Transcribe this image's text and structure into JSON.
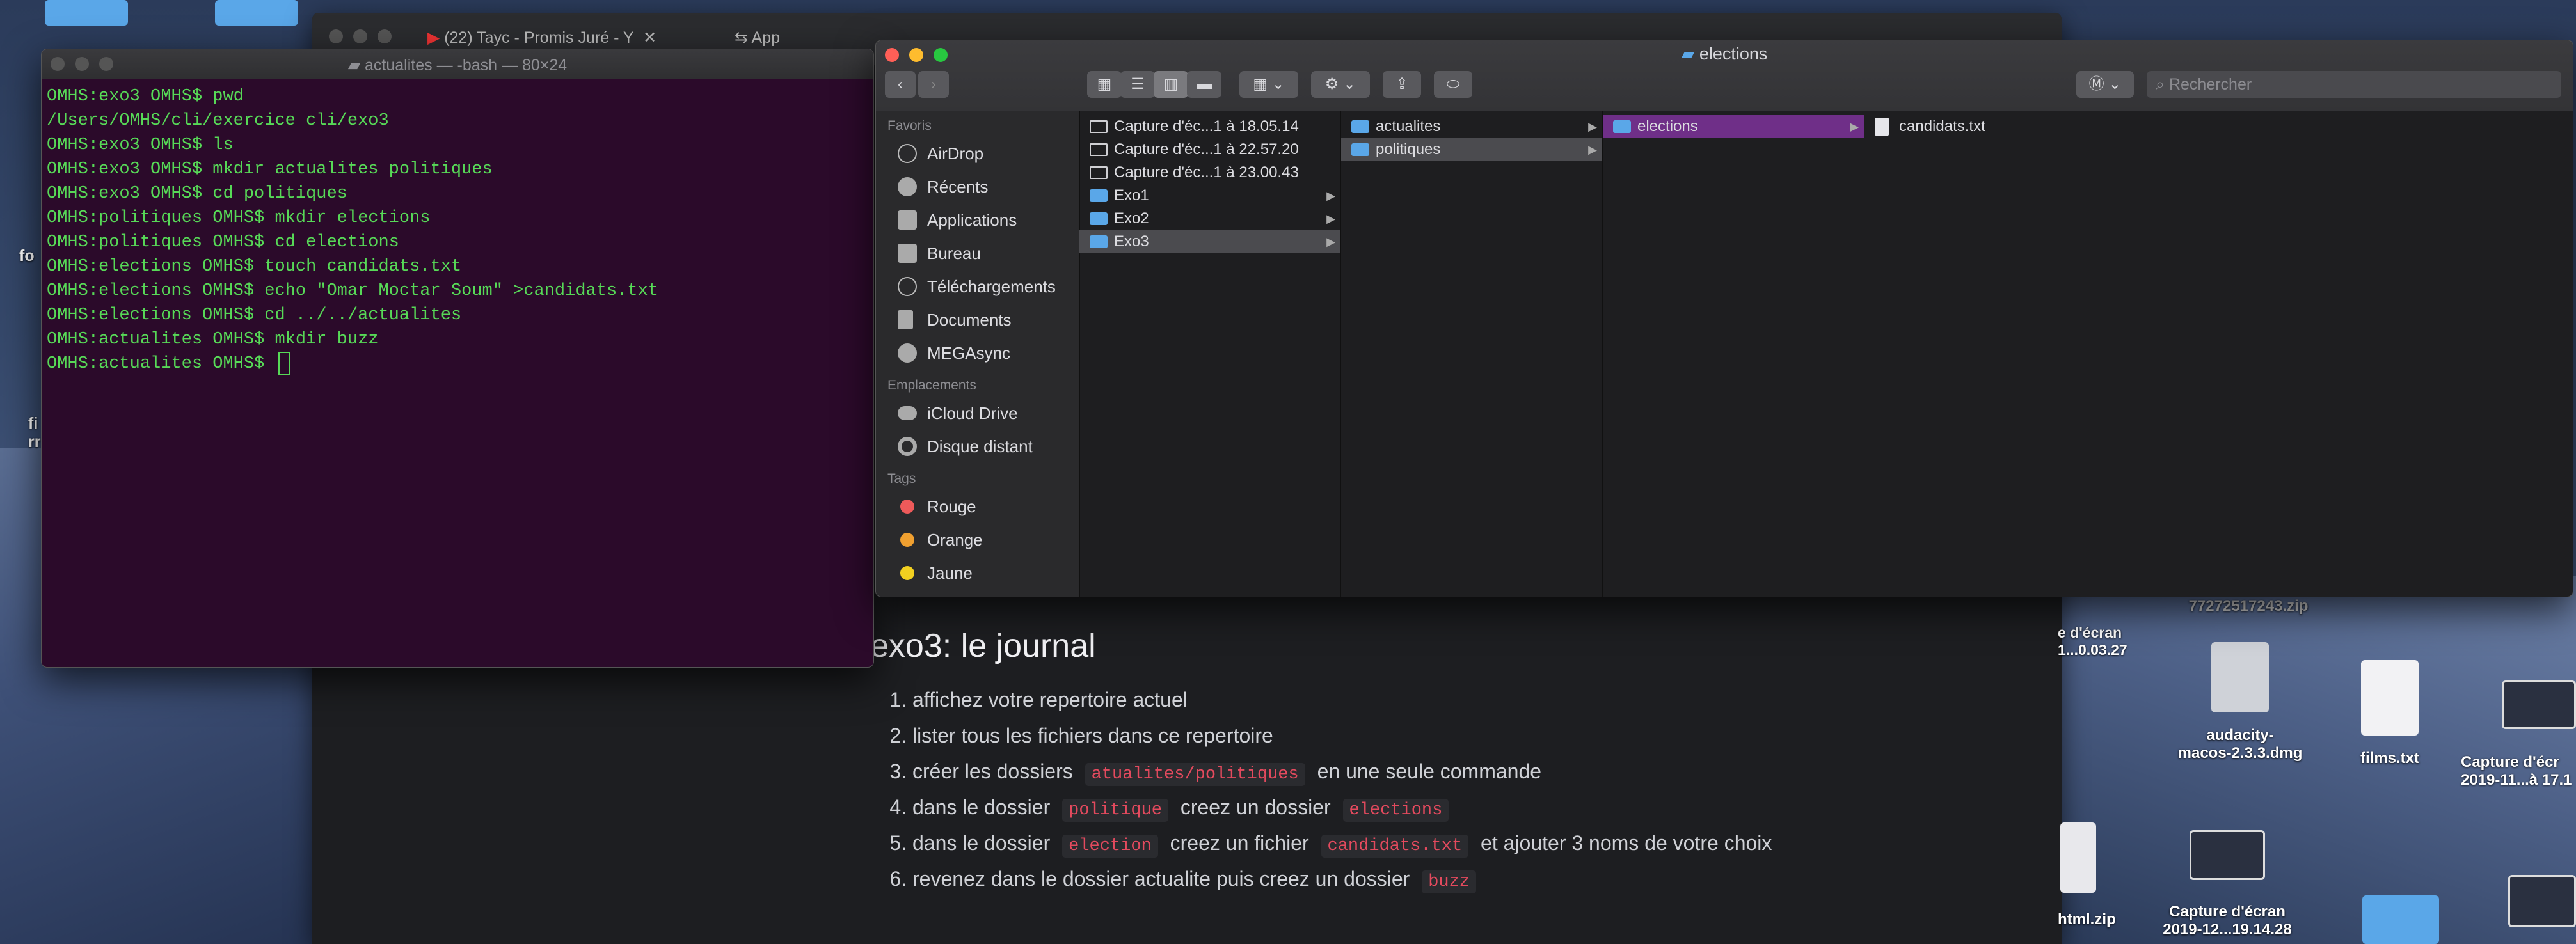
{
  "browser": {
    "tab1": "(22) Tayc - Promis Juré - Y",
    "tab2": "App"
  },
  "doc": {
    "heading": "exo3: le journal",
    "items": [
      {
        "text": "affichez votre repertoire actuel"
      },
      {
        "text": "lister tous les fichiers dans ce repertoire"
      },
      {
        "pre": "créer les dossiers ",
        "code": "atualites/politiques",
        "post": " en une seule commande"
      },
      {
        "pre": "dans le dossier ",
        "code": "politique",
        "mid": " creez un dossier ",
        "code2": "elections"
      },
      {
        "pre": "dans le dossier ",
        "code": "election",
        "mid": " creez un fichier ",
        "code2": "candidats.txt",
        "post": " et ajouter 3 noms de votre choix"
      },
      {
        "pre": "revenez dans le dossier actualite puis creez un dossier ",
        "code": "buzz"
      }
    ]
  },
  "terminal": {
    "title": "actualites — -bash — 80×24",
    "lines": [
      "OMHS:exo3 OMHS$ pwd",
      "/Users/OMHS/cli/exercice cli/exo3",
      "OMHS:exo3 OMHS$ ls",
      "OMHS:exo3 OMHS$ mkdir actualites politiques",
      "OMHS:exo3 OMHS$ cd politiques",
      "OMHS:politiques OMHS$ mkdir elections",
      "OMHS:politiques OMHS$ cd elections",
      "OMHS:elections OMHS$ touch candidats.txt",
      "OMHS:elections OMHS$ echo \"Omar Moctar Soum\" >candidats.txt",
      "OMHS:elections OMHS$ cd ../../actualites",
      "OMHS:actualites OMHS$ mkdir buzz",
      "OMHS:actualites OMHS$ "
    ]
  },
  "finder": {
    "title": "elections",
    "search_placeholder": "Rechercher",
    "sidebar": {
      "favorites_header": "Favoris",
      "favorites": [
        "AirDrop",
        "Récents",
        "Applications",
        "Bureau",
        "Téléchargements",
        "Documents",
        "MEGAsync"
      ],
      "locations_header": "Emplacements",
      "locations": [
        "iCloud Drive",
        "Disque distant"
      ],
      "tags_header": "Tags",
      "tags": [
        {
          "name": "Rouge",
          "color": "#ee5a5a"
        },
        {
          "name": "Orange",
          "color": "#f0a030"
        },
        {
          "name": "Jaune",
          "color": "#f2d020"
        }
      ]
    },
    "col1": [
      "Capture d'éc...1 à 18.05.14",
      "Capture d'éc...1 à 22.57.20",
      "Capture d'éc...1 à 23.00.43",
      "Exo1",
      "Exo2",
      "Exo3"
    ],
    "col2": [
      "actualites",
      "politiques"
    ],
    "col3": [
      "elections"
    ],
    "col4": [
      "candidats.txt"
    ]
  },
  "desktop": {
    "labels": {
      "zip_top": "77272517243.zip",
      "capture_left": "e d'écran\n1...0.03.27",
      "audacity": "audacity-\nmacos-2.3.3.dmg",
      "films": "films.txt",
      "capture_right": "Capture d'écr\n2019-11...à 17.1",
      "html_zip": "html.zip",
      "capture_bottom": "Capture d'écran\n2019-12...19.14.28",
      "left_fo": "fo",
      "left_fi": "fi\nrr"
    }
  },
  "colors": {
    "terminal_bg": "#2b0a2a",
    "terminal_text": "#57d957",
    "selection": "#6f2f88",
    "code_text": "#e44a5e"
  }
}
